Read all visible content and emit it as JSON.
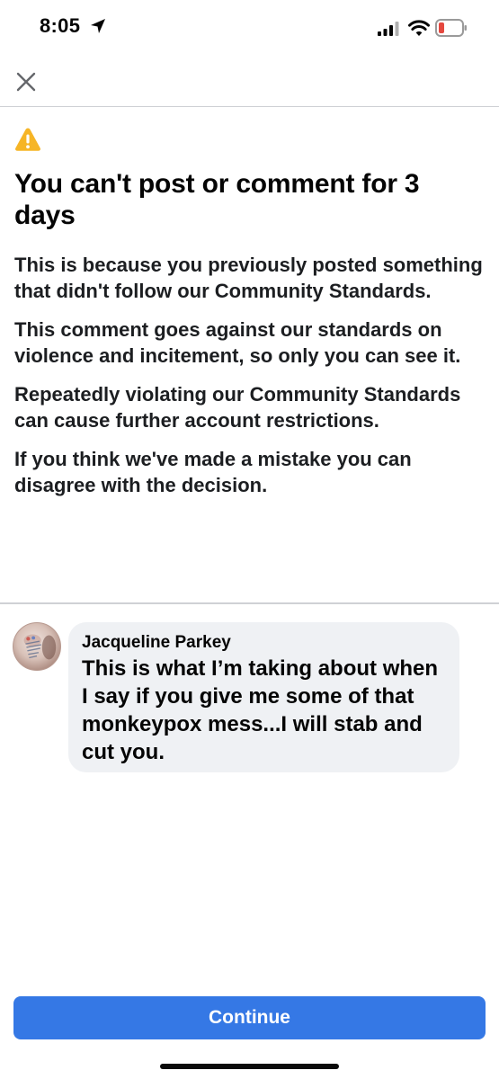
{
  "status_bar": {
    "time": "8:05",
    "icons": [
      "location-arrow-icon",
      "cellular-signal-icon",
      "wifi-icon",
      "battery-low-icon"
    ],
    "battery_color": "#e5483f"
  },
  "header": {
    "close_icon": "close-icon"
  },
  "notice": {
    "icon": "warning-icon",
    "icon_color": "#f6b526",
    "title": "You can't post or comment for 3 days",
    "paragraphs": [
      "This is because you previously posted something that didn't follow our Community Standards.",
      "This comment goes against our standards on violence and incitement, so only you can see it.",
      "Repeatedly violating our Community Standards can cause further account restrictions.",
      "If you think we've made a mistake you can disagree with the decision."
    ]
  },
  "comment": {
    "author": "Jacqueline Parkey",
    "text": "This is what I’m taking about when I say if you give me some of that monkeypox mess...I will stab and cut you."
  },
  "footer": {
    "continue_label": "Continue",
    "button_color": "#3578e5"
  }
}
